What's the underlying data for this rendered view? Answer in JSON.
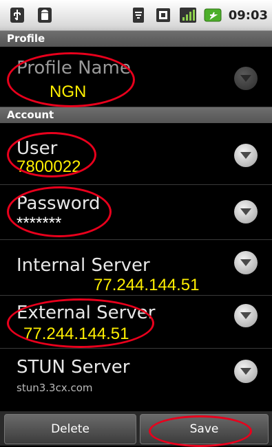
{
  "status_bar": {
    "time": "09:03",
    "icons": [
      "usb-icon",
      "android-icon",
      "wifi-icon",
      "sd-card-icon",
      "signal-icon",
      "battery-icon"
    ]
  },
  "sections": {
    "profile": "Profile",
    "account": "Account"
  },
  "rows": {
    "profile_name": {
      "title": "Profile Name",
      "value": "NGN"
    },
    "user": {
      "title": "User",
      "value": "7800022"
    },
    "password": {
      "title": "Password",
      "value": "*******"
    },
    "internal_server": {
      "title": "Internal Server",
      "value": "77.244.144.51"
    },
    "external_server": {
      "title": "External Server",
      "value": "77.244.144.51"
    },
    "stun_server": {
      "title": "STUN Server",
      "value": "stun3.3cx.com"
    }
  },
  "buttons": {
    "delete": "Delete",
    "save": "Save"
  },
  "colors": {
    "highlight": "#e8001c",
    "overlay_text": "#ffef00",
    "header_bg": "#5f5f5f"
  }
}
